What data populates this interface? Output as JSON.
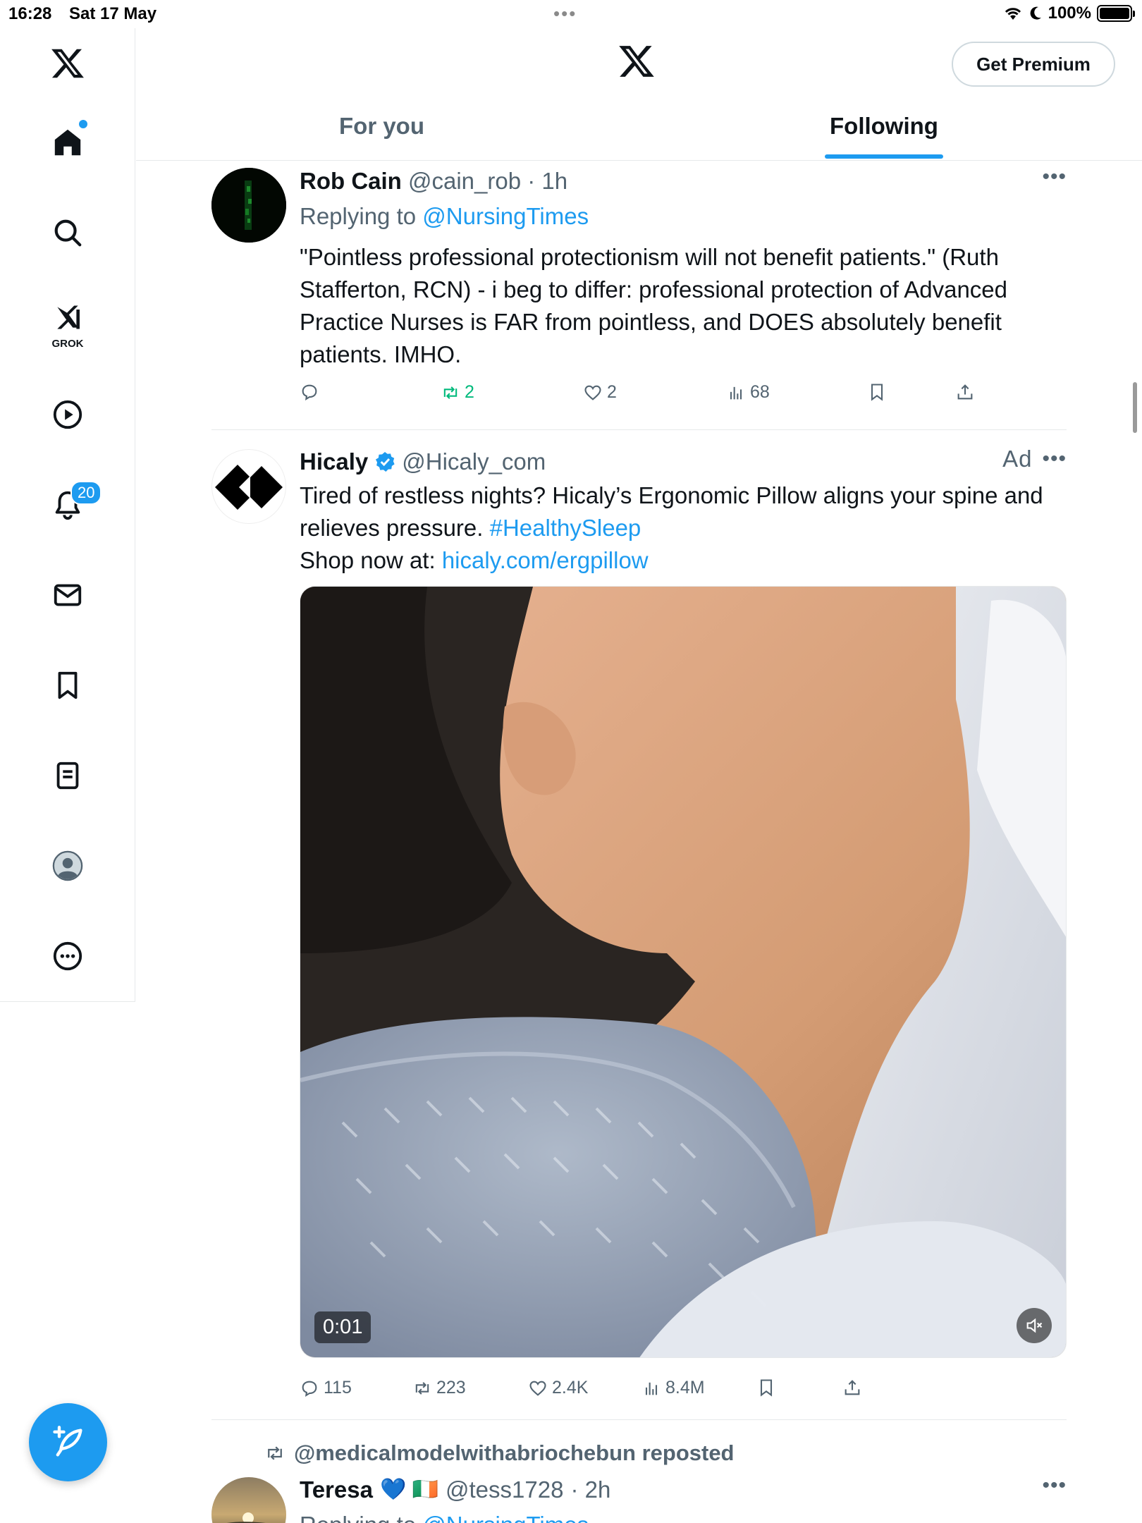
{
  "status": {
    "time": "16:28",
    "date": "Sat 17 May",
    "battery": "100%"
  },
  "sidebar": {
    "grok_label": "GROK",
    "notifications_count": "20",
    "items": [
      "home-icon",
      "search-icon",
      "grok-icon",
      "video-icon",
      "notifications-icon",
      "messages-icon",
      "bookmarks-icon",
      "lists-icon",
      "profile-icon",
      "more-icon"
    ]
  },
  "header": {
    "premium_label": "Get Premium",
    "tab_for_you": "For you",
    "tab_following": "Following"
  },
  "tweets": [
    {
      "name": "Rob Cain",
      "handle": "@cain_rob",
      "time": "· 1h",
      "replying_prefix": "Replying to",
      "replying_to": "@NursingTimes",
      "text": "\"Pointless professional protectionism will not benefit patients.\" (Ruth Stafferton, RCN) - i beg to differ: professional protection of Advanced Practice Nurses is FAR from pointless, and DOES absolutely benefit patients. IMHO.",
      "reposts": "2",
      "likes": "2",
      "views": "68"
    },
    {
      "name": "Hicaly",
      "handle": "@Hicaly_com",
      "ad_label": "Ad",
      "text_line1": "Tired of restless nights? Hicaly’s Ergonomic Pillow aligns your spine and",
      "text_line2": "relieves pressure.",
      "hashtag": "#HealthySleep",
      "shop_prefix": "Shop now at:",
      "shop_link": "hicaly.com/ergpillow",
      "video_time": "0:01",
      "replies": "115",
      "reposts": "223",
      "likes": "2.4K",
      "views": "8.4M"
    },
    {
      "reposted_by": "@medicalmodelwithabriochebun reposted",
      "name": "Teresa",
      "name_emoji": "💙 🇮🇪",
      "handle": "@tess1728",
      "time": "· 2h",
      "replying_prefix": "Replying to",
      "replying_to": "@NursingTimes"
    }
  ],
  "colors": {
    "accent": "#1d9bf0",
    "repost_green": "#00ba7c",
    "text_secondary": "#536471"
  }
}
